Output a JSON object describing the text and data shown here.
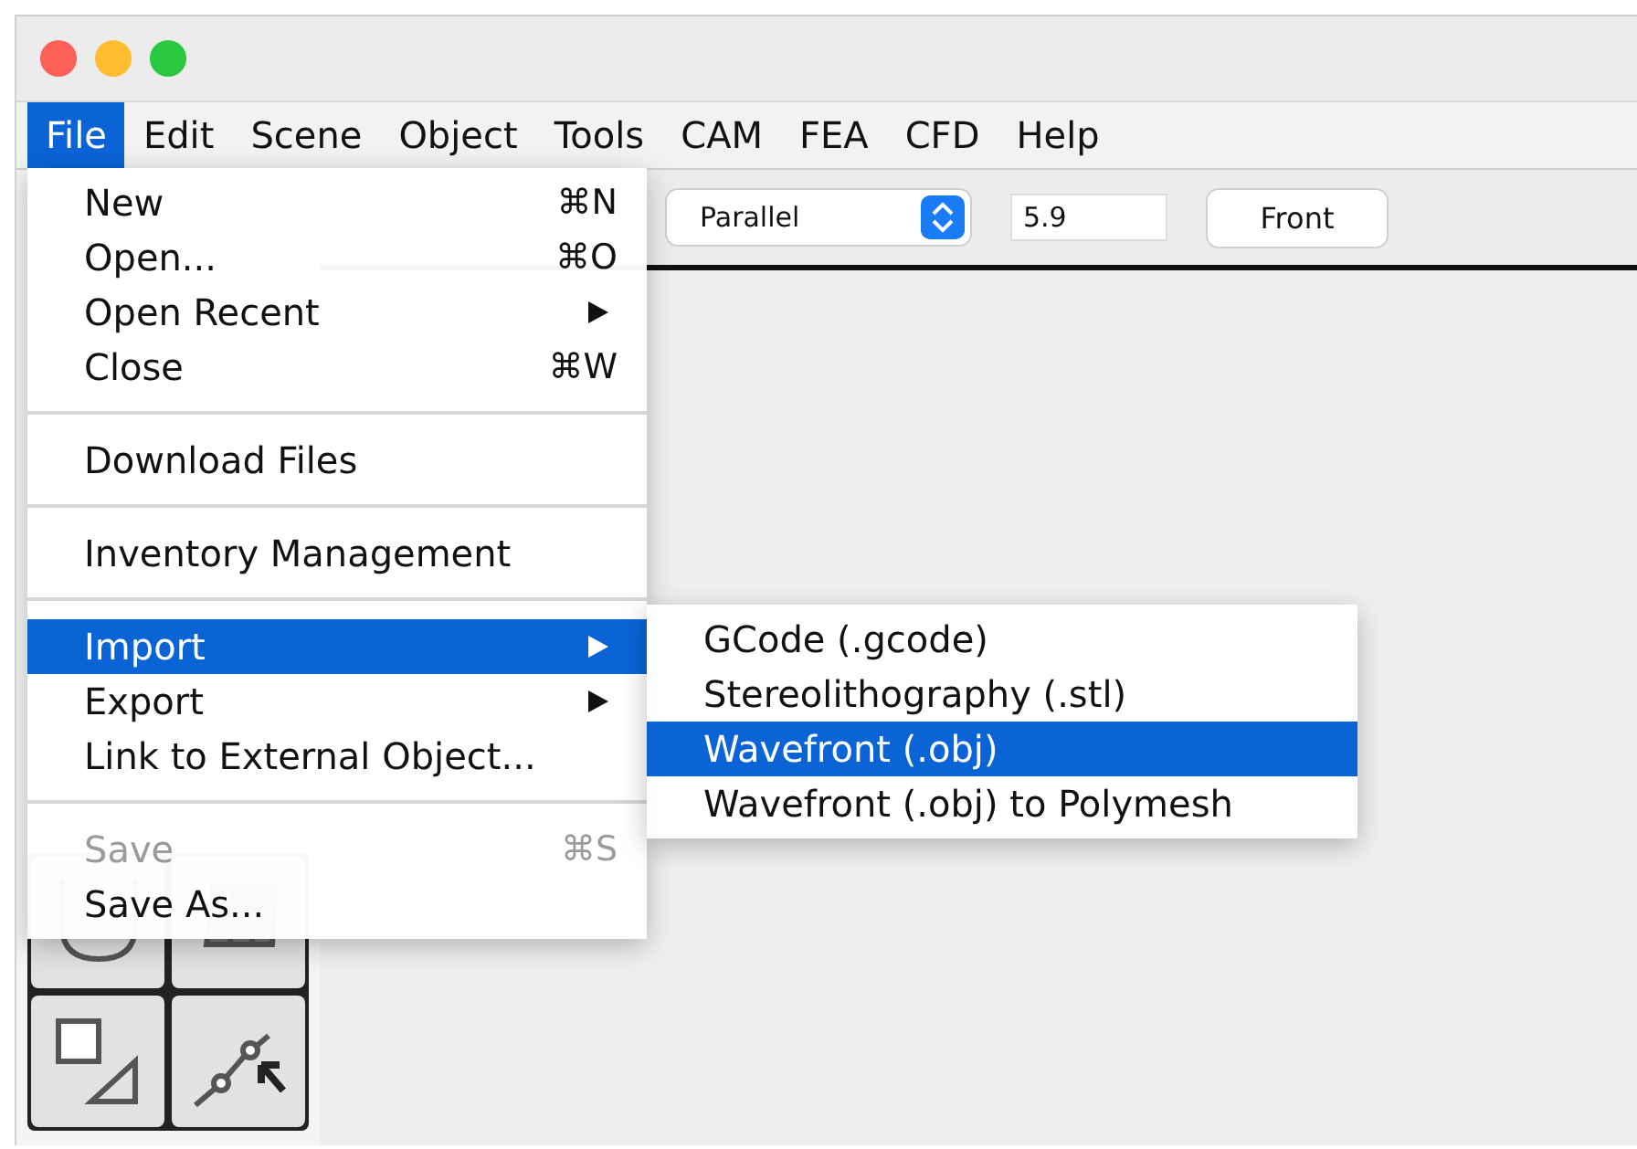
{
  "menu_bar": [
    {
      "label": "File",
      "selected": true
    },
    {
      "label": "Edit",
      "selected": false
    },
    {
      "label": "Scene",
      "selected": false
    },
    {
      "label": "Object",
      "selected": false
    },
    {
      "label": "Tools",
      "selected": false
    },
    {
      "label": "CAM",
      "selected": false
    },
    {
      "label": "FEA",
      "selected": false
    },
    {
      "label": "CFD",
      "selected": false
    },
    {
      "label": "Help",
      "selected": false
    }
  ],
  "toolbar": {
    "projection": "Parallel",
    "scale": "5.9",
    "view_button": "Front"
  },
  "file_menu": [
    {
      "kind": "item",
      "label": "New",
      "shortcut": "⌘N",
      "submenu": false,
      "disabled": false,
      "selected": false
    },
    {
      "kind": "item",
      "label": "Open...",
      "shortcut": "⌘O",
      "submenu": false,
      "disabled": false,
      "selected": false
    },
    {
      "kind": "item",
      "label": "Open Recent",
      "submenu": true,
      "disabled": false,
      "selected": false
    },
    {
      "kind": "item",
      "label": "Close",
      "shortcut": "⌘W",
      "submenu": false,
      "disabled": false,
      "selected": false
    },
    {
      "kind": "separator"
    },
    {
      "kind": "item",
      "label": "Download Files",
      "submenu": false,
      "disabled": false,
      "selected": false
    },
    {
      "kind": "separator"
    },
    {
      "kind": "item",
      "label": "Inventory Management",
      "submenu": false,
      "disabled": false,
      "selected": false
    },
    {
      "kind": "separator"
    },
    {
      "kind": "item",
      "label": "Import",
      "submenu": true,
      "disabled": false,
      "selected": true
    },
    {
      "kind": "item",
      "label": "Export",
      "submenu": true,
      "disabled": false,
      "selected": false
    },
    {
      "kind": "item",
      "label": "Link to External Object...",
      "submenu": false,
      "disabled": false,
      "selected": false
    },
    {
      "kind": "separator"
    },
    {
      "kind": "item",
      "label": "Save",
      "shortcut": "⌘S",
      "submenu": false,
      "disabled": true,
      "selected": false
    },
    {
      "kind": "item",
      "label": "Save As...",
      "submenu": false,
      "disabled": false,
      "selected": false
    }
  ],
  "import_submenu": [
    {
      "label": "GCode (.gcode)",
      "selected": false
    },
    {
      "label": "Stereolithography (.stl)",
      "selected": false
    },
    {
      "label": "Wavefront (.obj)",
      "selected": true
    },
    {
      "label": "Wavefront (.obj) to Polymesh",
      "selected": false
    }
  ]
}
